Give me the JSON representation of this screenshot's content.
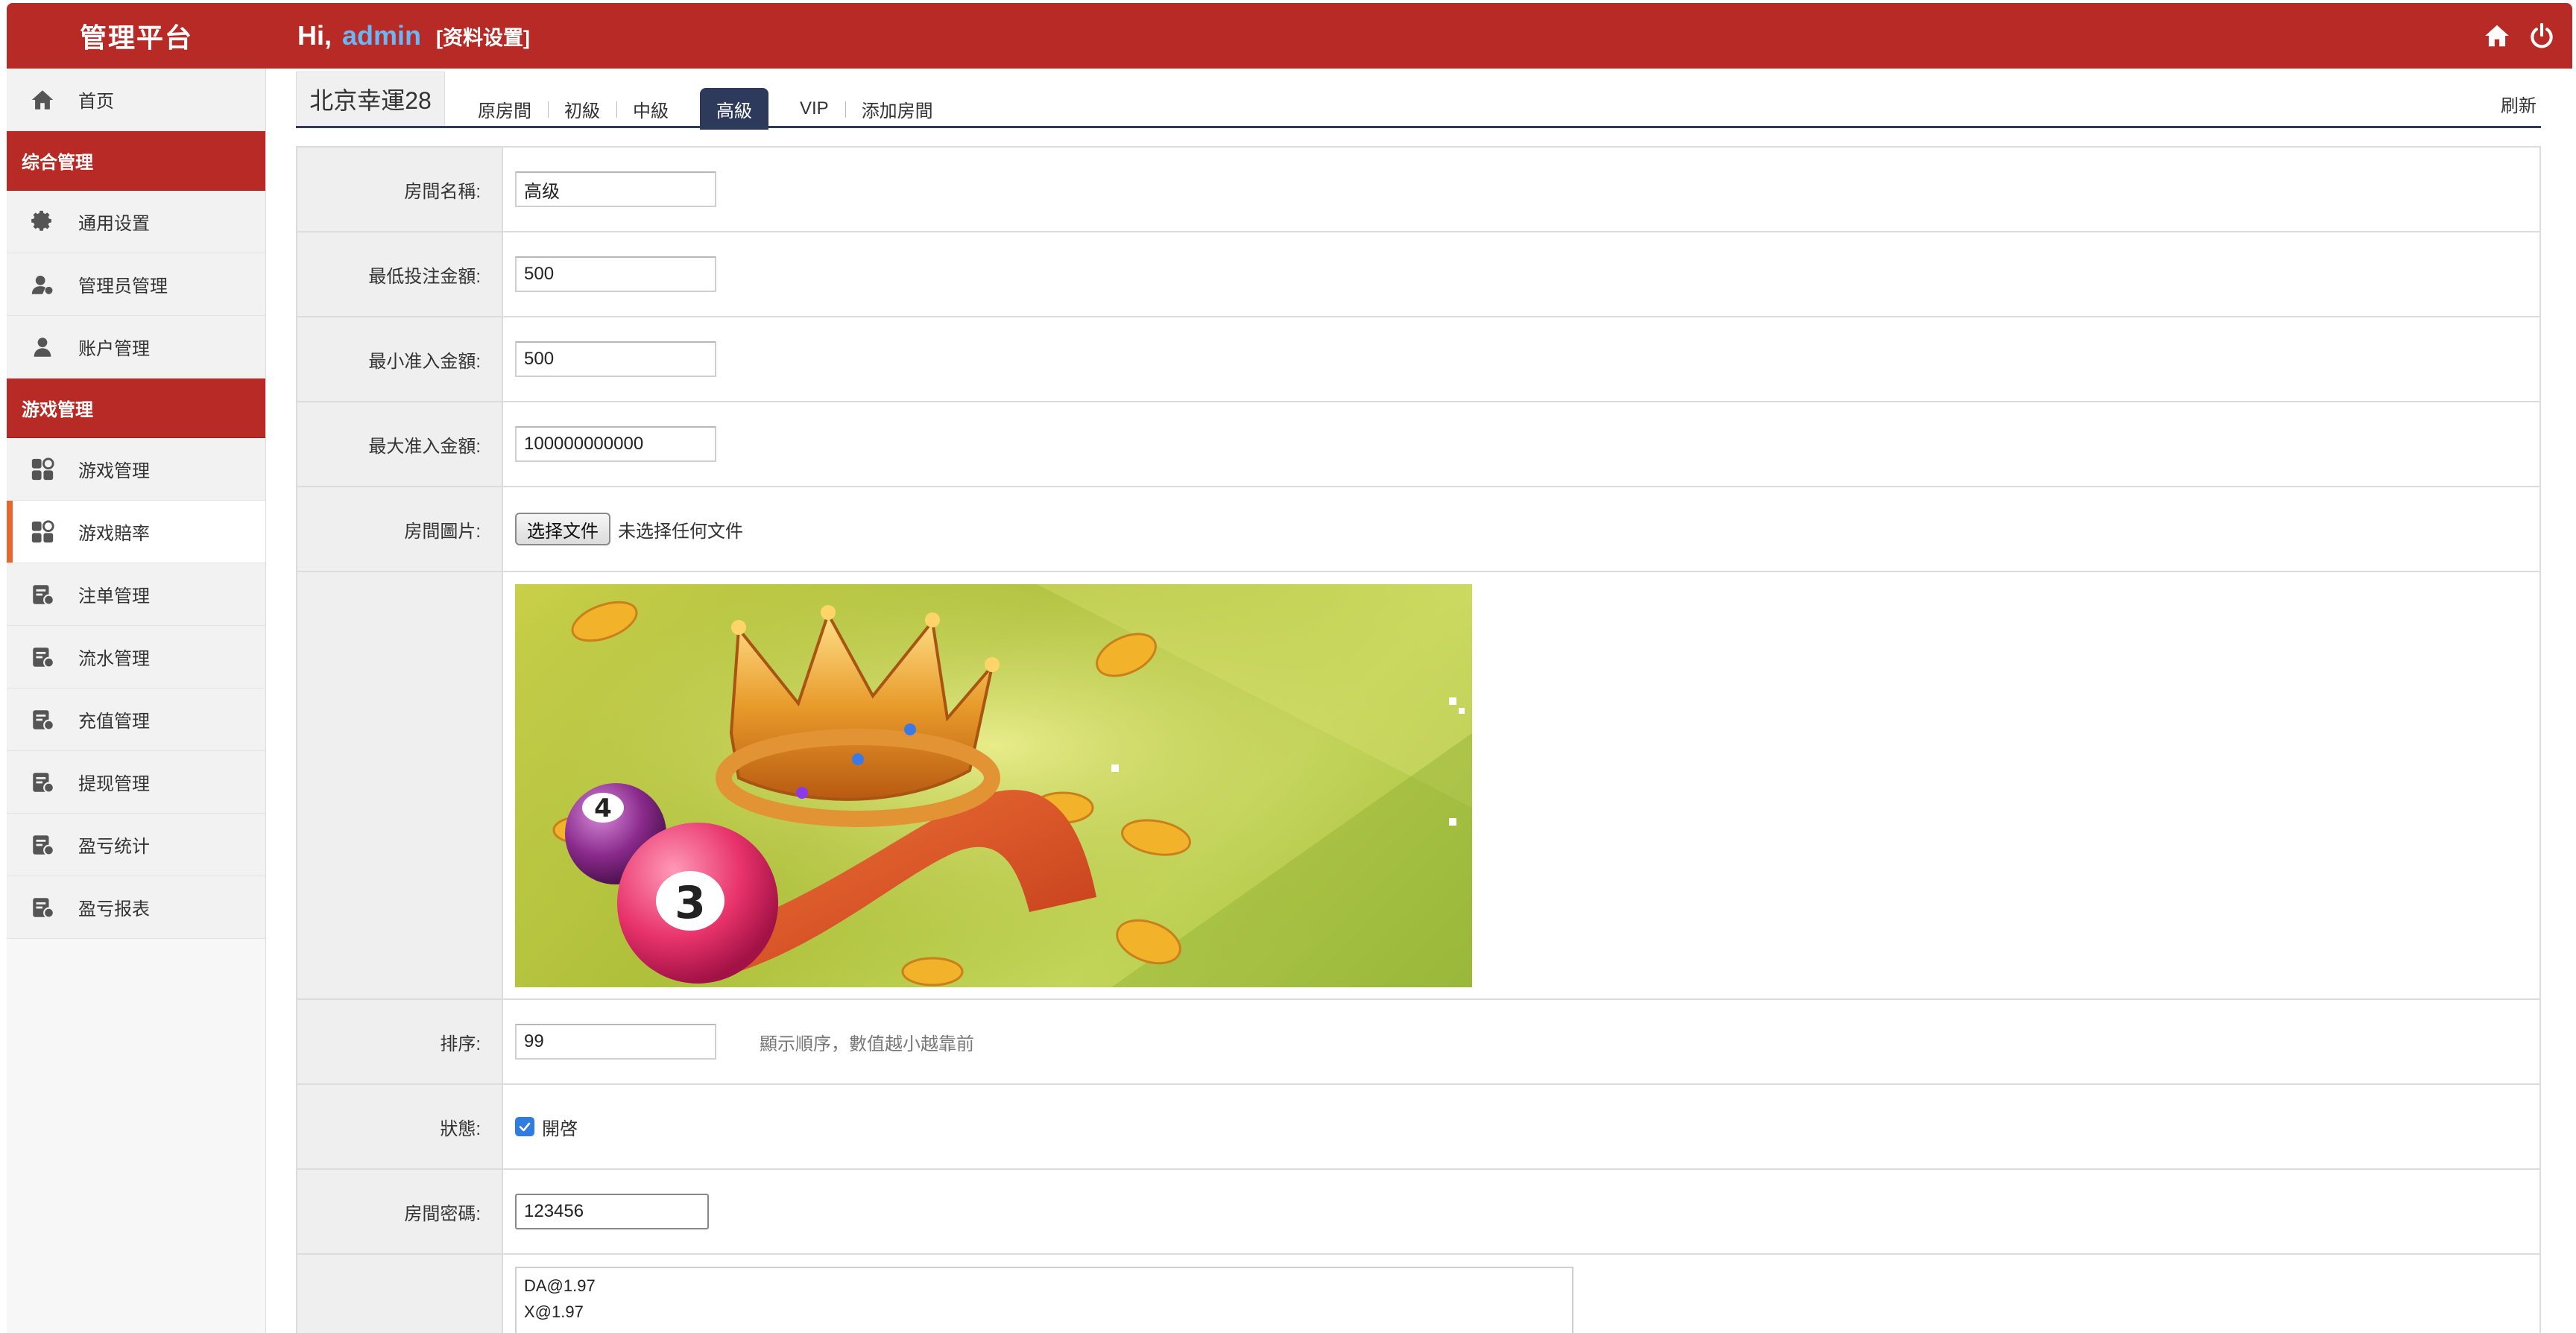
{
  "header": {
    "brand": "管理平台",
    "greeting_prefix": "Hi,",
    "username": "admin",
    "settings_link": "[资料设置]",
    "icons": [
      "home-icon",
      "power-icon"
    ]
  },
  "sidebar": {
    "home": {
      "label": "首页",
      "icon": "home-icon"
    },
    "sections": [
      {
        "title": "综合管理",
        "items": [
          {
            "label": "通用设置",
            "icon": "gear-icon"
          },
          {
            "label": "管理员管理",
            "icon": "admin-users-icon"
          },
          {
            "label": "账户管理",
            "icon": "user-icon"
          }
        ]
      },
      {
        "title": "游戏管理",
        "items": [
          {
            "label": "游戏管理",
            "icon": "apps-icon"
          },
          {
            "label": "游戏賠率",
            "icon": "apps-icon",
            "active": true
          },
          {
            "label": "注单管理",
            "icon": "ledger-icon"
          },
          {
            "label": "流水管理",
            "icon": "ledger-icon"
          },
          {
            "label": "充值管理",
            "icon": "ledger-icon"
          },
          {
            "label": "提现管理",
            "icon": "ledger-icon"
          },
          {
            "label": "盈亏统计",
            "icon": "ledger-icon"
          },
          {
            "label": "盈亏报表",
            "icon": "ledger-icon"
          }
        ]
      }
    ]
  },
  "main": {
    "room_title": "北京幸運28",
    "tabs": [
      "原房間",
      "初級",
      "中級",
      "高級",
      "VIP",
      "添加房間"
    ],
    "active_tab": "高級",
    "refresh": "刷新",
    "form": {
      "room_name": {
        "label": "房間名稱:",
        "value": "高级"
      },
      "min_bet": {
        "label": "最低投注金額:",
        "value": "500"
      },
      "min_entry": {
        "label": "最小准入金額:",
        "value": "500"
      },
      "max_entry": {
        "label": "最大准入金額:",
        "value": "100000000000"
      },
      "room_image": {
        "label": "房間圖片:",
        "button": "选择文件",
        "note": "未选择任何文件"
      },
      "sort": {
        "label": "排序:",
        "value": "99",
        "hint": "顯示順序，數值越小越靠前"
      },
      "status": {
        "label": "狀態:",
        "option": "開啓",
        "checked": true
      },
      "password": {
        "label": "房間密碼:",
        "value": "123456"
      },
      "odds_lines": [
        "DA@1.97",
        "X@1.97"
      ]
    }
  },
  "colors": {
    "brand_red": "#b82a25",
    "tab_active": "#2e3a5c",
    "active_marker": "#e8672a",
    "username": "#6cb6f5",
    "checkbox": "#2f7de1"
  }
}
